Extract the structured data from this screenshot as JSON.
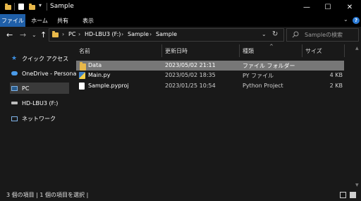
{
  "window": {
    "title": "Sample",
    "minimize": "—",
    "maximize": "☐",
    "close": "✕"
  },
  "ribbon": {
    "tabs": [
      "ファイル",
      "ホーム",
      "共有",
      "表示"
    ],
    "help": "?",
    "expand": "⌄"
  },
  "nav": {
    "back": "←",
    "forward": "→",
    "recent": "⌄",
    "up": "↑",
    "path": [
      "PC",
      "HD-LBU3 (F:)",
      "Sample",
      "Sample"
    ],
    "separator": "›",
    "dropdown": "⌄",
    "refresh": "↻",
    "search_placeholder": "Sampleの検索"
  },
  "sidebar": {
    "items": [
      {
        "label": "クイック アクセス",
        "icon": "star-icon"
      },
      {
        "label": "OneDrive - Persona",
        "icon": "cloud-icon"
      },
      {
        "label": "PC",
        "icon": "computer-icon",
        "selected": true
      },
      {
        "label": "HD-LBU3 (F:)",
        "icon": "drive-icon"
      },
      {
        "label": "ネットワーク",
        "icon": "network-icon"
      }
    ]
  },
  "files": {
    "columns": [
      "名前",
      "更新日時",
      "種類",
      "サイズ"
    ],
    "sort_indicator": "^",
    "rows": [
      {
        "name": "Data",
        "modified": "2023/05/02 21:11",
        "type": "ファイル フォルダー",
        "size": "",
        "icon": "folder-icon",
        "selected": true
      },
      {
        "name": "Main.py",
        "modified": "2023/05/02 18:35",
        "type": "PY ファイル",
        "size": "4 KB",
        "icon": "python-file-icon"
      },
      {
        "name": "Sample.pyproj",
        "modified": "2023/01/25 10:54",
        "type": "Python Project",
        "size": "2 KB",
        "icon": "document-icon"
      }
    ]
  },
  "status": {
    "text": "3 個の項目  |  1 個の項目を選択  |"
  },
  "colors": {
    "accent": "#1f5fa8",
    "selection": "#777777",
    "folder": "#e8b84a"
  }
}
